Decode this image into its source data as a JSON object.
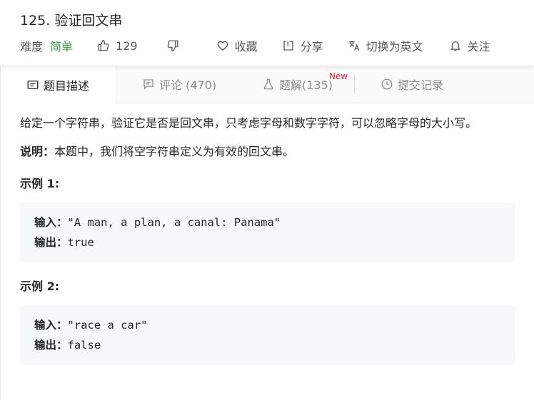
{
  "problem": {
    "title": "125. 验证回文串"
  },
  "meta": {
    "difficulty_label": "难度",
    "difficulty": "简单",
    "likes": "129",
    "favorite_label": "收藏",
    "share_label": "分享",
    "switch_lang_label": "切换为英文",
    "follow_label": "关注"
  },
  "tabs": [
    {
      "label": "题目描述",
      "icon": "description-icon"
    },
    {
      "label": "评论 (470)",
      "icon": "comment-icon"
    },
    {
      "label": "题解(135)",
      "icon": "flask-icon",
      "badge": "New"
    },
    {
      "label": "提交记录",
      "icon": "clock-icon"
    }
  ],
  "description": {
    "text": "给定一个字符串，验证它是否是回文串，只考虑字母和数字字符，可以忽略字母的大小写。",
    "note_label": "说明：",
    "note_text": "本题中，我们将空字符串定义为有效的回文串。"
  },
  "examples": [
    {
      "heading": "示例 1:",
      "input_label": "输入：",
      "input": "\"A man, a plan, a canal: Panama\"",
      "output_label": "输出：",
      "output": "true"
    },
    {
      "heading": "示例 2:",
      "input_label": "输入：",
      "input": "\"race a car\"",
      "output_label": "输出：",
      "output": "false"
    }
  ],
  "colors": {
    "easy": "#43a047",
    "new_badge": "#f5222d"
  }
}
